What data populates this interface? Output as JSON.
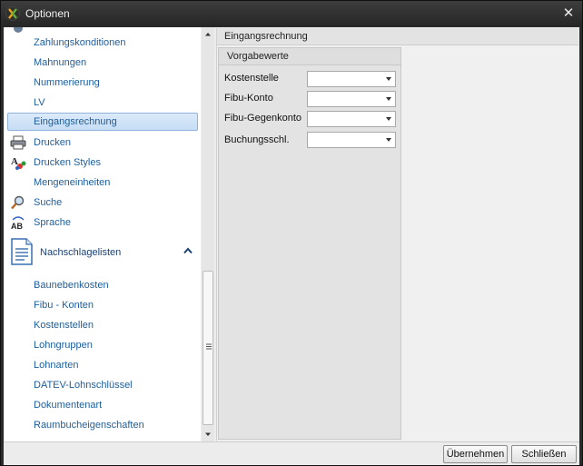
{
  "window": {
    "title": "Optionen"
  },
  "sidebar": {
    "items": [
      {
        "label": "Zahlungskonditionen"
      },
      {
        "label": "Mahnungen"
      },
      {
        "label": "Nummerierung"
      },
      {
        "label": "LV"
      },
      {
        "label": "Eingangsrechnung",
        "selected": true
      },
      {
        "label": "Drucken",
        "icon": "printer-icon"
      },
      {
        "label": "Drucken Styles",
        "icon": "styles-icon"
      },
      {
        "label": "Mengeneinheiten"
      },
      {
        "label": "Suche",
        "icon": "magnifier-icon"
      },
      {
        "label": "Sprache",
        "icon": "language-icon"
      }
    ],
    "section": {
      "label": "Nachschlagelisten",
      "icon": "document-icon",
      "expanded": true
    },
    "section_items": [
      {
        "label": "Baunebenkosten"
      },
      {
        "label": "Fibu - Konten"
      },
      {
        "label": "Kostenstellen"
      },
      {
        "label": "Lohngruppen"
      },
      {
        "label": "Lohnarten"
      },
      {
        "label": "DATEV-Lohnschlüssel"
      },
      {
        "label": "Dokumentenart"
      },
      {
        "label": "Raumbucheigenschaften"
      }
    ]
  },
  "content": {
    "header": "Eingangsrechnung",
    "group": {
      "title": "Vorgabewerte",
      "fields": [
        {
          "label": "Kostenstelle",
          "value": ""
        },
        {
          "label": "Fibu-Konto",
          "value": ""
        },
        {
          "label": "Fibu-Gegenkonto",
          "value": ""
        },
        {
          "label": "Buchungsschl.",
          "value": ""
        }
      ]
    }
  },
  "buttons": {
    "apply": "Übernehmen",
    "close": "Schließen"
  },
  "colors": {
    "link": "#1d5e9c",
    "selection": "#c6ddf4",
    "titlebar": "#2b2b2b"
  }
}
